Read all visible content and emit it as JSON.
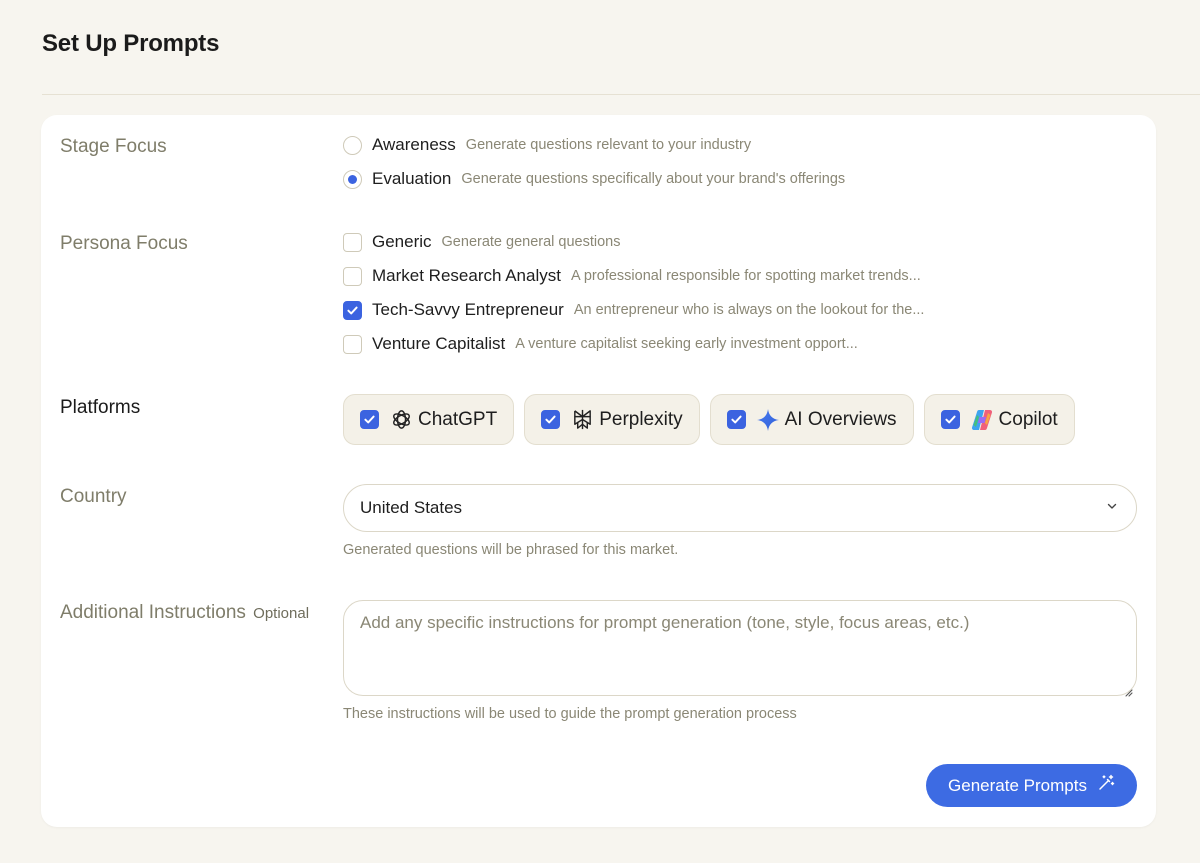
{
  "page": {
    "title": "Set Up Prompts"
  },
  "stage_focus": {
    "label": "Stage Focus",
    "options": [
      {
        "label": "Awareness",
        "description": "Generate questions relevant to your industry",
        "selected": false
      },
      {
        "label": "Evaluation",
        "description": "Generate questions specifically about your brand's offerings",
        "selected": true
      }
    ]
  },
  "persona_focus": {
    "label": "Persona Focus",
    "options": [
      {
        "label": "Generic",
        "description": "Generate general questions",
        "checked": false
      },
      {
        "label": "Market Research Analyst",
        "description": "A professional responsible for spotting market trends...",
        "checked": false
      },
      {
        "label": "Tech-Savvy Entrepreneur",
        "description": "An entrepreneur who is always on the lookout for the...",
        "checked": true
      },
      {
        "label": "Venture Capitalist",
        "description": "A venture capitalist seeking early investment opport...",
        "checked": false
      }
    ]
  },
  "platforms": {
    "label": "Platforms",
    "items": [
      {
        "label": "ChatGPT",
        "icon": "chatgpt-icon",
        "checked": true
      },
      {
        "label": "Perplexity",
        "icon": "perplexity-icon",
        "checked": true
      },
      {
        "label": "AI Overviews",
        "icon": "ai-overviews-sparkle-icon",
        "checked": true
      },
      {
        "label": "Copilot",
        "icon": "copilot-icon",
        "checked": true
      }
    ]
  },
  "country": {
    "label": "Country",
    "value": "United States",
    "helper": "Generated questions will be phrased for this market."
  },
  "instructions": {
    "label": "Additional Instructions",
    "optional_label": "Optional",
    "placeholder": "Add any specific instructions for prompt generation (tone, style, focus areas, etc.)",
    "helper": "These instructions will be used to guide the prompt generation process"
  },
  "actions": {
    "generate_label": "Generate Prompts"
  },
  "colors": {
    "accent": "#3d6be3",
    "background": "#f7f5ef",
    "muted_text": "#8a8775"
  }
}
